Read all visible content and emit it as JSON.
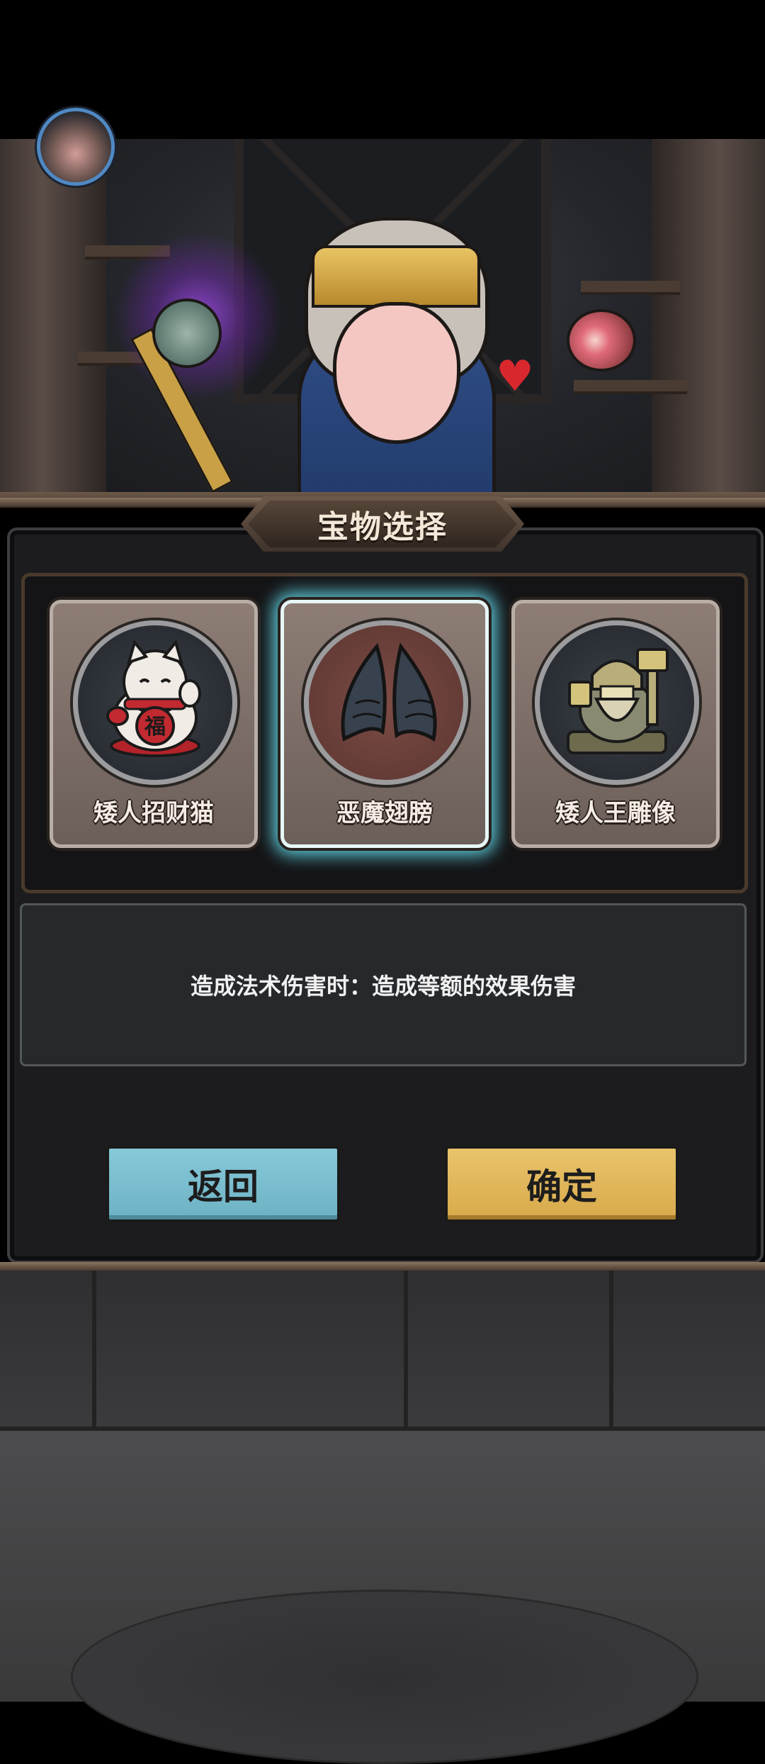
{
  "header": {
    "avatar_icon": "helmet-avatar-icon"
  },
  "dialog": {
    "title": "宝物选择",
    "options": [
      {
        "label": "矮人招财猫",
        "icon": "lucky-cat-icon",
        "selected": false
      },
      {
        "label": "恶魔翅膀",
        "icon": "demon-wings-icon",
        "selected": true
      },
      {
        "label": "矮人王雕像",
        "icon": "dwarf-king-statue-icon",
        "selected": false
      }
    ],
    "description": "造成法术伤害时：造成等额的效果伤害",
    "back_label": "返回",
    "confirm_label": "确定"
  },
  "colors": {
    "back_button": "#7fc0d1",
    "confirm_button": "#e3b95c",
    "selected_glow": "#5fd0e0",
    "avatar_ring": "#4f89c3"
  }
}
